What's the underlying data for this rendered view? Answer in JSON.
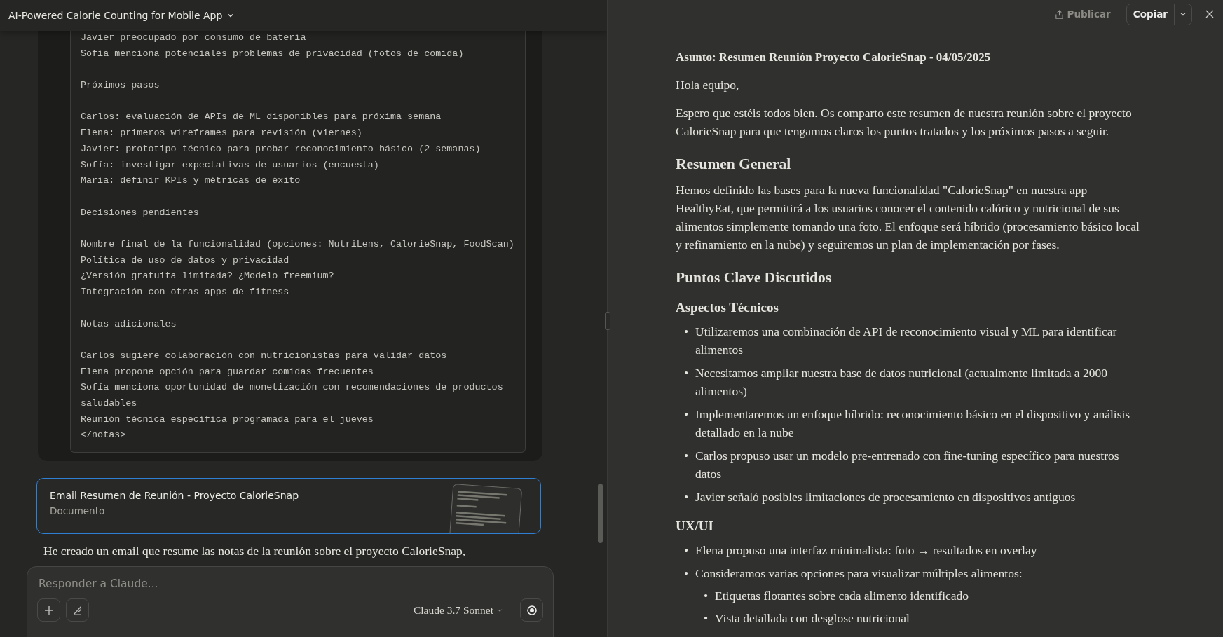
{
  "conversation": {
    "title": "AI-Powered Calorie Counting for Mobile App",
    "code_groups": [
      [
        "Javier preocupado por consumo de batería",
        "Sofía menciona potenciales problemas de privacidad (fotos de comida)"
      ],
      [
        "Próximos pasos"
      ],
      [
        "Carlos: evaluación de APIs de ML disponibles para próxima semana",
        "Elena: primeros wireframes para revisión (viernes)",
        "Javier: prototipo técnico para probar reconocimiento básico (2 semanas)",
        "Sofía: investigar expectativas de usuarios (encuesta)",
        "María: definir KPIs y métricas de éxito"
      ],
      [
        "Decisiones pendientes"
      ],
      [
        "Nombre final de la funcionalidad (opciones: NutriLens, CalorieSnap, FoodScan)",
        "Política de uso de datos y privacidad",
        "¿Versión gratuita limitada? ¿Modelo freemium?",
        "Integración con otras apps de fitness"
      ],
      [
        "Notas adicionales"
      ],
      [
        "Carlos sugiere colaboración con nutricionistas para validar datos",
        "Elena propone opción para guardar comidas frecuentes",
        "Sofía menciona oportunidad de monetización con recomendaciones de productos saludables",
        "Reunión técnica específica programada para el jueves",
        "</notas>"
      ]
    ],
    "artifact_card": {
      "title": "Email Resumen de Reunión - Proyecto CalorieSnap",
      "subtitle": "Documento",
      "selected": true
    },
    "message": "He creado un email que resume las notas de la reunión sobre el proyecto CalorieSnap,",
    "composer": {
      "placeholder": "Responder a Claude...",
      "model": "Claude 3.7 Sonnet"
    }
  },
  "artifact": {
    "publish_label": "Publicar",
    "copy_label": "Copiar",
    "blocks": [
      {
        "kind": "subject",
        "text": "Asunto: Resumen Reunión Proyecto CalorieSnap - 04/05/2025"
      },
      {
        "kind": "paragraph",
        "text": "Hola equipo,"
      },
      {
        "kind": "paragraph",
        "text": "Espero que estéis todos bien. Os comparto este resumen de nuestra reunión sobre el proyecto CalorieSnap para que tengamos claros los puntos tratados y los próximos pasos a seguir."
      },
      {
        "kind": "h2",
        "text": "Resumen General"
      },
      {
        "kind": "paragraph",
        "text": "Hemos definido las bases para la nueva funcionalidad \"CalorieSnap\" en nuestra app HealthyEat, que permitirá a los usuarios conocer el contenido calórico y nutricional de sus alimentos simplemente tomando una foto. El enfoque será híbrido (procesamiento básico local y refinamiento en la nube) y seguiremos un plan de implementación por fases."
      },
      {
        "kind": "h2",
        "text": "Puntos Clave Discutidos"
      },
      {
        "kind": "h3",
        "text": "Aspectos Técnicos"
      },
      {
        "kind": "list",
        "items": [
          {
            "bullet": "•",
            "text": "Utilizaremos una combinación de API de reconocimiento visual y ML para identificar alimentos"
          },
          {
            "bullet": "•",
            "text": "Necesitamos ampliar nuestra base de datos nutricional (actualmente limitada a 2000 alimentos)"
          },
          {
            "bullet": "•",
            "text": "Implementaremos un enfoque híbrido: reconocimiento básico en el dispositivo y análisis detallado en la nube"
          },
          {
            "bullet": "•",
            "text": "Carlos propuso usar un modelo pre-entrenado con fine-tuning específico para nuestros datos"
          },
          {
            "bullet": "•",
            "text": "Javier señaló posibles limitaciones de procesamiento en dispositivos antiguos"
          }
        ]
      },
      {
        "kind": "h3",
        "text": "UX/UI"
      },
      {
        "kind": "list",
        "items": [
          {
            "bullet": "•",
            "text": "Elena propuso una interfaz minimalista: foto → resultados en overlay"
          },
          {
            "bullet": "•",
            "text": "Consideramos varias opciones para visualizar múltiples alimentos:",
            "children": [
              {
                "bullet": "•",
                "text": "Etiquetas flotantes sobre cada alimento identificado"
              },
              {
                "bullet": "•",
                "text": "Vista detallada con desglose nutricional"
              }
            ]
          }
        ]
      }
    ]
  }
}
